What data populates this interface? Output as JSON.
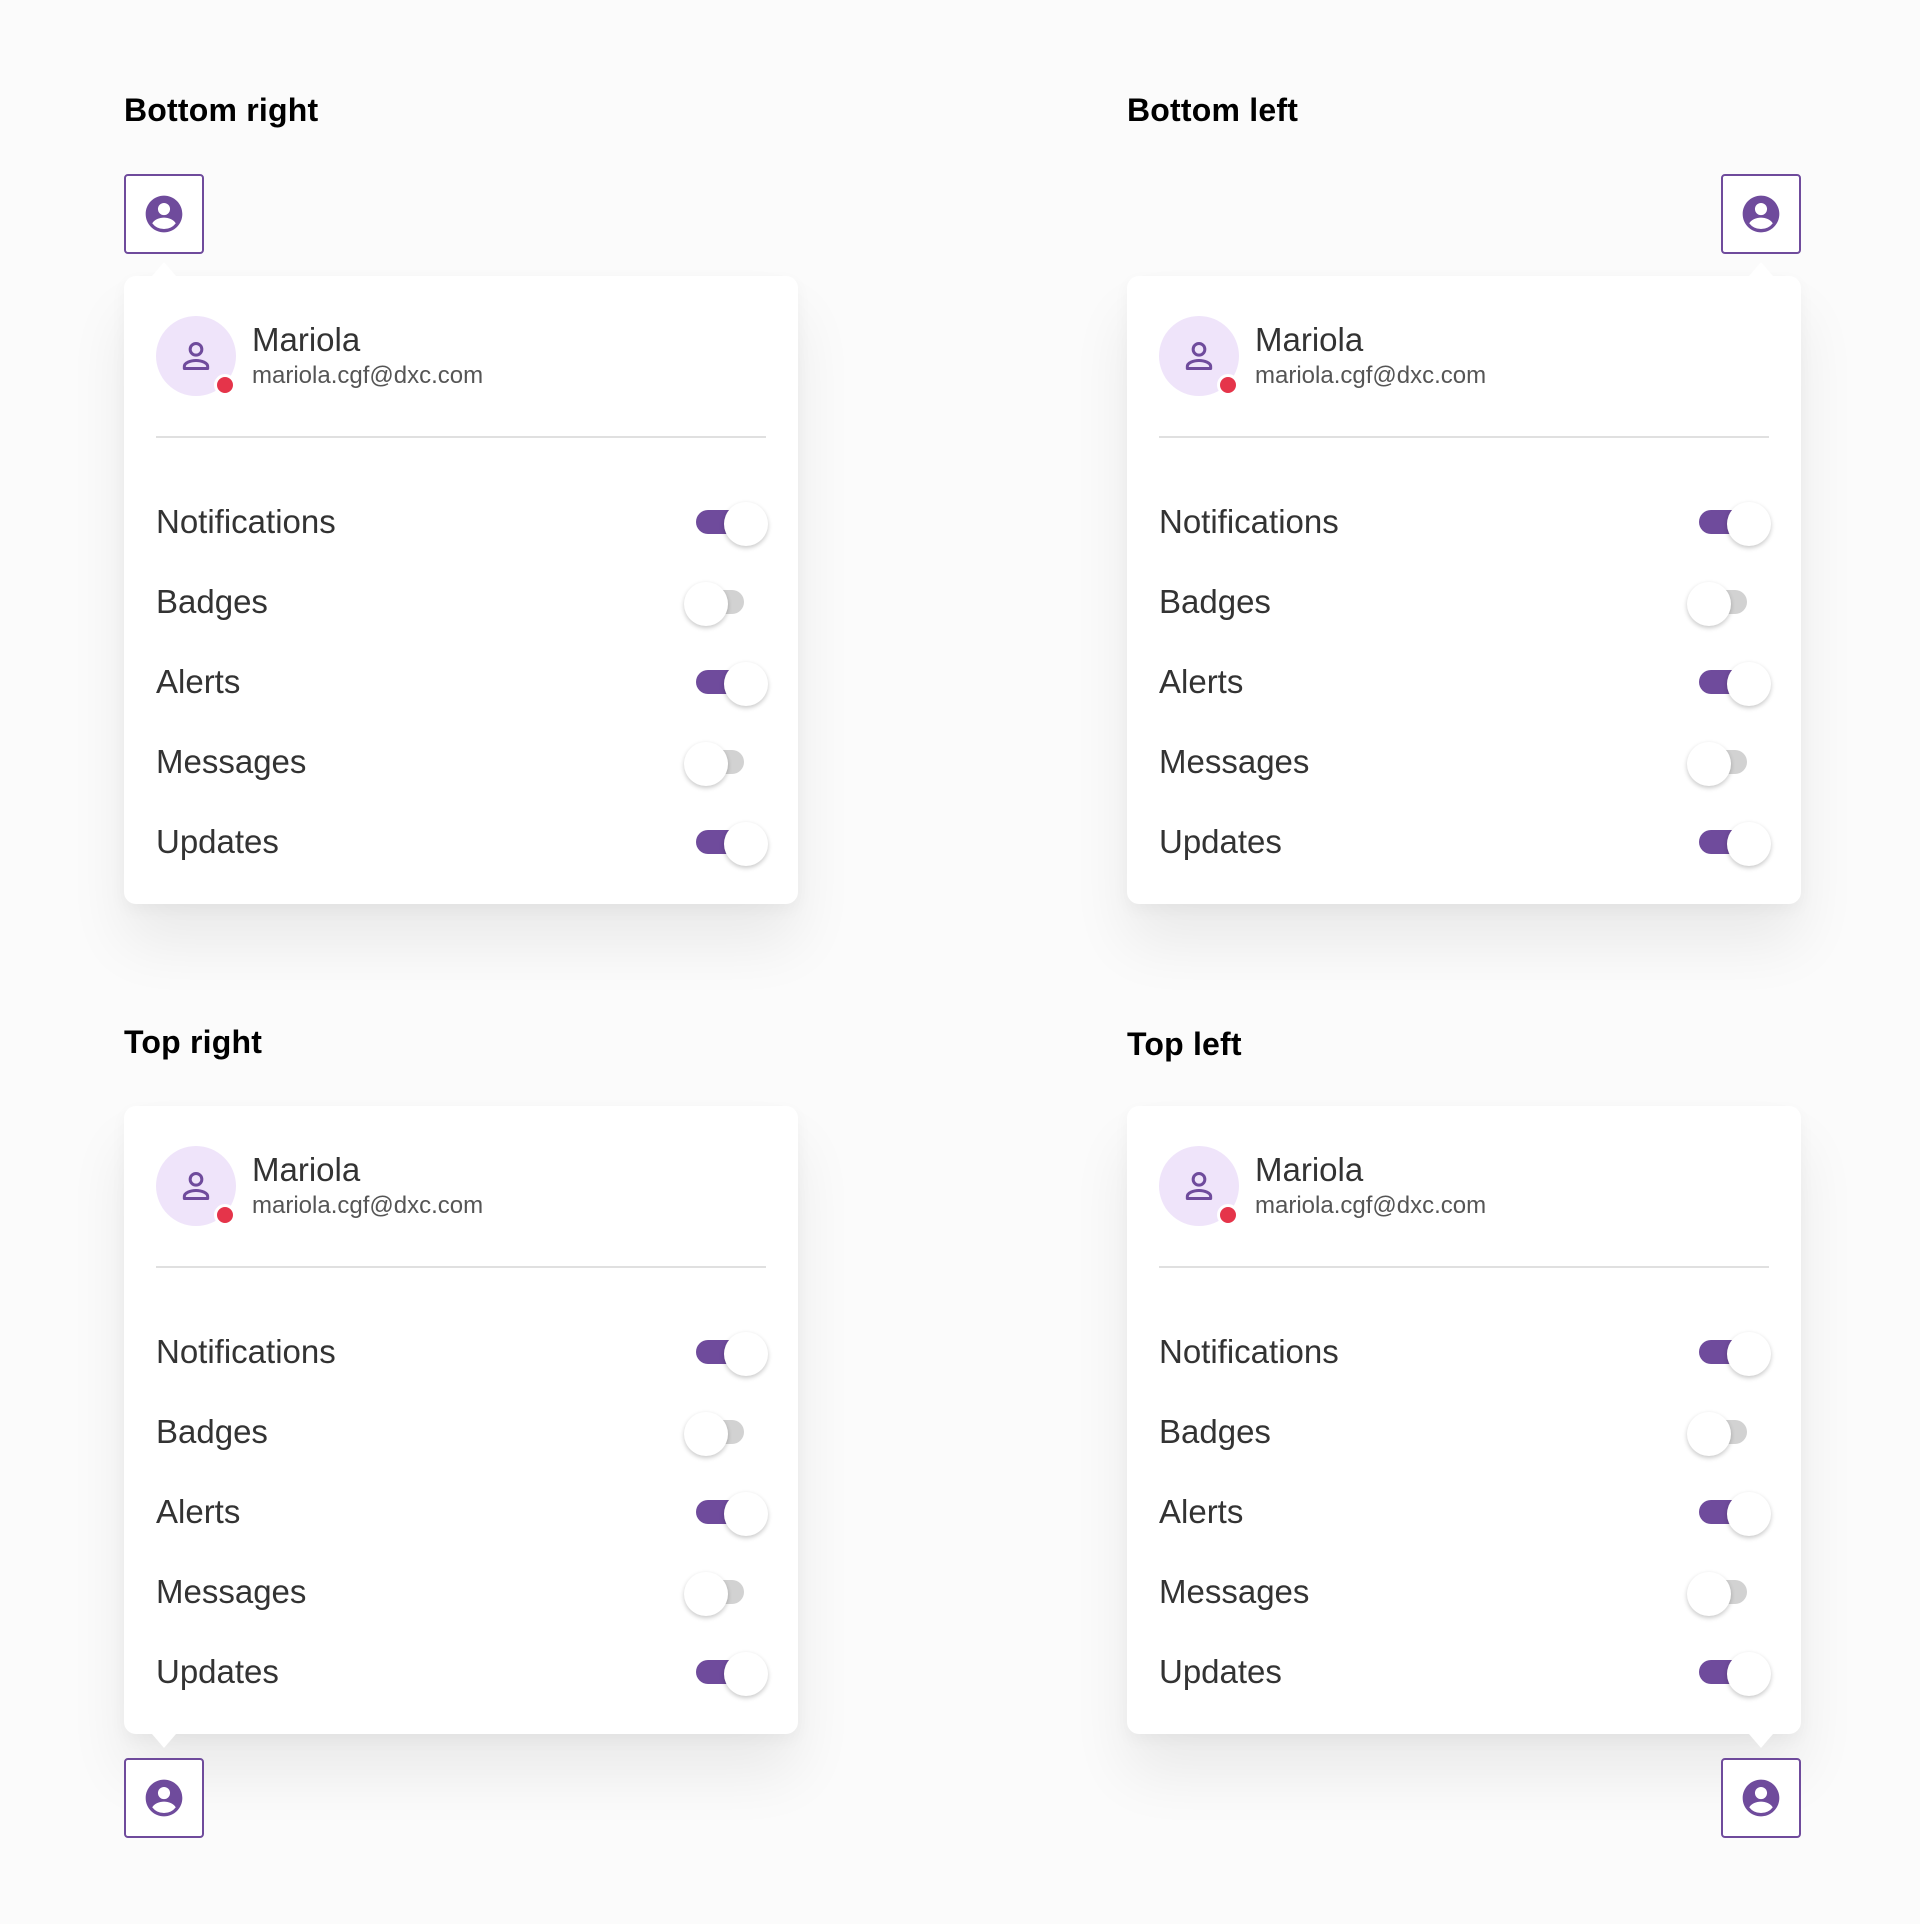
{
  "colors": {
    "accent": "#6f4b9c",
    "avatar_bg": "#efe4fa",
    "status": "#e5344a",
    "switch_off": "#d2d2d2"
  },
  "icons": {
    "trigger": "account-circle-icon",
    "avatar": "person-outline-icon"
  },
  "sections": [
    {
      "title": "Bottom right",
      "user": {
        "name": "Mariola",
        "email": "mariola.cgf@dxc.com"
      },
      "settings": [
        {
          "label": "Notifications",
          "on": true
        },
        {
          "label": "Badges",
          "on": false
        },
        {
          "label": "Alerts",
          "on": true
        },
        {
          "label": "Messages",
          "on": false
        },
        {
          "label": "Updates",
          "on": true
        }
      ]
    },
    {
      "title": "Bottom left",
      "user": {
        "name": "Mariola",
        "email": "mariola.cgf@dxc.com"
      },
      "settings": [
        {
          "label": "Notifications",
          "on": true
        },
        {
          "label": "Badges",
          "on": false
        },
        {
          "label": "Alerts",
          "on": true
        },
        {
          "label": "Messages",
          "on": false
        },
        {
          "label": "Updates",
          "on": true
        }
      ]
    },
    {
      "title": "Top right",
      "user": {
        "name": "Mariola",
        "email": "mariola.cgf@dxc.com"
      },
      "settings": [
        {
          "label": "Notifications",
          "on": true
        },
        {
          "label": "Badges",
          "on": false
        },
        {
          "label": "Alerts",
          "on": true
        },
        {
          "label": "Messages",
          "on": false
        },
        {
          "label": "Updates",
          "on": true
        }
      ]
    },
    {
      "title": "Top left",
      "user": {
        "name": "Mariola",
        "email": "mariola.cgf@dxc.com"
      },
      "settings": [
        {
          "label": "Notifications",
          "on": true
        },
        {
          "label": "Badges",
          "on": false
        },
        {
          "label": "Alerts",
          "on": true
        },
        {
          "label": "Messages",
          "on": false
        },
        {
          "label": "Updates",
          "on": true
        }
      ]
    }
  ]
}
